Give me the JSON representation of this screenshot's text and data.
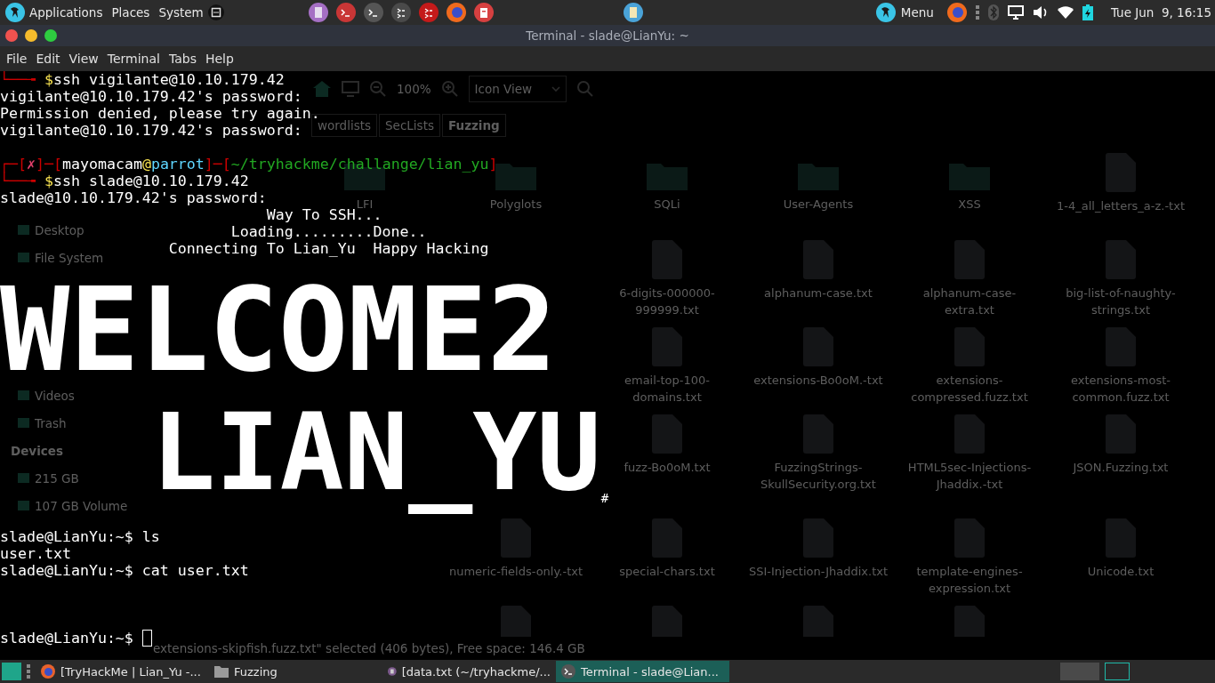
{
  "top_panel": {
    "menus": [
      "Applications",
      "Places",
      "System"
    ],
    "menu_button": "Menu",
    "clock": "Tue Jun  9, 16:15"
  },
  "window": {
    "title": "Terminal - slade@LianYu: ~",
    "menu": [
      "File",
      "Edit",
      "View",
      "Terminal",
      "Tabs",
      "Help"
    ]
  },
  "file_manager": {
    "toolbar": {
      "zoom": "100%",
      "view": "Icon View"
    },
    "breadcrumbs": [
      {
        "label": "wordlists",
        "selected": false
      },
      {
        "label": "SecLists",
        "selected": false
      },
      {
        "label": "Fuzzing",
        "selected": true
      }
    ],
    "sidebar": [
      {
        "kind": "header"
      },
      {
        "kind": "item"
      },
      {
        "kind": "item",
        "label": "Desktop"
      },
      {
        "kind": "item",
        "label": "File System"
      },
      {
        "kind": "item"
      },
      {
        "kind": "item"
      },
      {
        "kind": "item"
      },
      {
        "kind": "item"
      },
      {
        "kind": "item",
        "label": "Videos"
      },
      {
        "kind": "item",
        "label": "Trash"
      },
      {
        "kind": "header",
        "label": "Devices"
      },
      {
        "kind": "item",
        "label": "215 GB"
      },
      {
        "kind": "item",
        "label": "107 GB Volume"
      }
    ],
    "rows": [
      [
        {
          "kind": "gap"
        },
        {
          "kind": "folder",
          "name": "LFI"
        },
        {
          "kind": "folder",
          "name": "Polyglots"
        },
        {
          "kind": "folder",
          "name": "SQLi"
        },
        {
          "kind": "folder",
          "name": "User-Agents"
        },
        {
          "kind": "folder",
          "name": "XSS"
        },
        {
          "kind": "file",
          "name": "1-4_all_letters_a-z.-txt"
        }
      ],
      [
        {
          "kind": "gap"
        },
        {
          "kind": "gap"
        },
        {
          "kind": "gap"
        },
        {
          "kind": "file",
          "name": "6-digits-000000-999999.txt"
        },
        {
          "kind": "file",
          "name": "alphanum-case.txt"
        },
        {
          "kind": "file",
          "name": "alphanum-case-extra.txt"
        },
        {
          "kind": "file",
          "name": "big-list-of-naughty-strings.txt"
        }
      ],
      [
        {
          "kind": "gap"
        },
        {
          "kind": "gap"
        },
        {
          "kind": "gap"
        },
        {
          "kind": "file",
          "name": "email-top-100-domains.txt"
        },
        {
          "kind": "file",
          "name": "extensions-Bo0oM.-txt"
        },
        {
          "kind": "file",
          "name": "extensions-compressed.fuzz.txt"
        },
        {
          "kind": "file",
          "name": "extensions-most-common.fuzz.txt"
        }
      ],
      [
        {
          "kind": "gap"
        },
        {
          "kind": "gap"
        },
        {
          "kind": "gap"
        },
        {
          "kind": "file",
          "name": "fuzz-Bo0oM.txt"
        },
        {
          "kind": "file",
          "name": "FuzzingStrings-SkullSecurity.org.txt"
        },
        {
          "kind": "file",
          "name": "HTML5sec-Injections-Jhaddix.-txt"
        },
        {
          "kind": "file",
          "name": "JSON.Fuzzing.txt"
        }
      ],
      [
        {
          "kind": "gap"
        },
        {
          "kind": "gap"
        },
        {
          "kind": "file",
          "name": "numeric-fields-only.-txt"
        },
        {
          "kind": "file",
          "name": "special-chars.txt"
        },
        {
          "kind": "file",
          "name": "SSI-Injection-Jhaddix.txt"
        },
        {
          "kind": "file",
          "name": "template-engines-expression.txt"
        },
        {
          "kind": "file",
          "name": "Unicode.txt"
        }
      ],
      [
        {
          "kind": "gap"
        },
        {
          "kind": "gap"
        },
        {
          "kind": "file"
        },
        {
          "kind": "file"
        },
        {
          "kind": "file"
        },
        {
          "kind": "file"
        }
      ]
    ],
    "status": "extensions-skipfish.fuzz.txt\" selected (406 bytes), Free space: 146.4 GB"
  },
  "terminal": [
    {
      "kind": "cmd",
      "corner": "└──╼ ",
      "sign": "$",
      "text": "ssh vigilante@10.10.179.42"
    },
    {
      "kind": "plain",
      "text": "vigilante@10.10.179.42's password:"
    },
    {
      "kind": "plain",
      "text": "Permission denied, please try again."
    },
    {
      "kind": "plain",
      "text": "vigilante@10.10.179.42's password:"
    },
    {
      "kind": "blank"
    },
    {
      "kind": "head",
      "parts": [
        {
          "text": "┌─[",
          "color": "#cc0000"
        },
        {
          "text": "✗",
          "color": "#e0406a"
        },
        {
          "text": "]─[",
          "color": "#cc0000"
        },
        {
          "text": "mayomacam",
          "color": "#ffffff"
        },
        {
          "text": "@",
          "color": "#f5e050"
        },
        {
          "text": "parrot",
          "color": "#5fd7ff"
        },
        {
          "text": "]─[",
          "color": "#cc0000"
        },
        {
          "text": "~/tryhackme/challange/lian_yu",
          "color": "#22a822"
        },
        {
          "text": "]",
          "color": "#cc0000"
        }
      ]
    },
    {
      "kind": "cmd",
      "corner": "└──╼ ",
      "sign": "$",
      "text": "ssh slade@10.10.179.42"
    },
    {
      "kind": "plain",
      "text": "slade@10.10.179.42's password:"
    },
    {
      "kind": "plain",
      "text": "                              Way To SSH..."
    },
    {
      "kind": "plain",
      "text": "                          Loading.........Done.."
    },
    {
      "kind": "plain",
      "text": "                   Connecting To Lian_Yu  Happy Hacking"
    },
    {
      "kind": "banner",
      "text": "WELCOME2",
      "indented": false
    },
    {
      "kind": "banner",
      "text": "LIAN_YU",
      "indented": true,
      "suffix": "#"
    },
    {
      "kind": "shell",
      "prompt": "slade@LianYu:~$",
      "text": "ls"
    },
    {
      "kind": "plain",
      "text": "user.txt"
    },
    {
      "kind": "shell",
      "prompt": "slade@LianYu:~$",
      "text": "cat user.txt"
    },
    {
      "kind": "redacted"
    },
    {
      "kind": "blank"
    },
    {
      "kind": "shell",
      "prompt": "slade@LianYu:~$",
      "cursor": true
    }
  ],
  "taskbar": {
    "tasks": [
      {
        "kind": "browser",
        "label": "[TryHackMe | Lian_Yu -...",
        "selected": false
      },
      {
        "kind": "folder",
        "label": "Fuzzing",
        "selected": false
      },
      {
        "kind": "editor",
        "label": "[data.txt (~/tryhackme/...",
        "selected": false
      },
      {
        "kind": "terminal",
        "label": "Terminal - slade@Lian...",
        "selected": true
      }
    ],
    "workspaces": [
      {
        "selected": true
      },
      {
        "selected": false
      }
    ]
  }
}
